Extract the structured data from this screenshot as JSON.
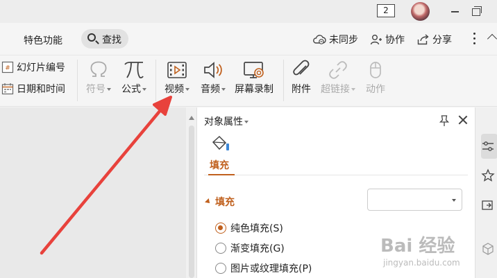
{
  "titlebar": {
    "tab_count": "2"
  },
  "menubar": {
    "special_features": "特色功能",
    "search_label": "查找",
    "sync_status": "未同步",
    "collaborate": "协作",
    "share": "分享"
  },
  "ribbon": {
    "slide_number": "幻灯片编号",
    "date_time": "日期和时间",
    "symbol": "符号",
    "formula": "公式",
    "video": "视频",
    "audio": "音频",
    "screen_record": "屏幕录制",
    "attachment": "附件",
    "hyperlink": "超链接",
    "action": "动作"
  },
  "panel": {
    "title": "对象属性",
    "tab_fill": "填充",
    "section_fill": "填充",
    "fill_select_value": "",
    "options": {
      "solid": "纯色填充(S)",
      "gradient": "渐变填充(G)",
      "picture": "图片或纹理填充(P)"
    }
  },
  "watermark": {
    "brand": "Bai 经验",
    "url": "jingyan.baidu.com"
  },
  "colors": {
    "accent": "#c0601d",
    "arrow": "#e8423c"
  }
}
